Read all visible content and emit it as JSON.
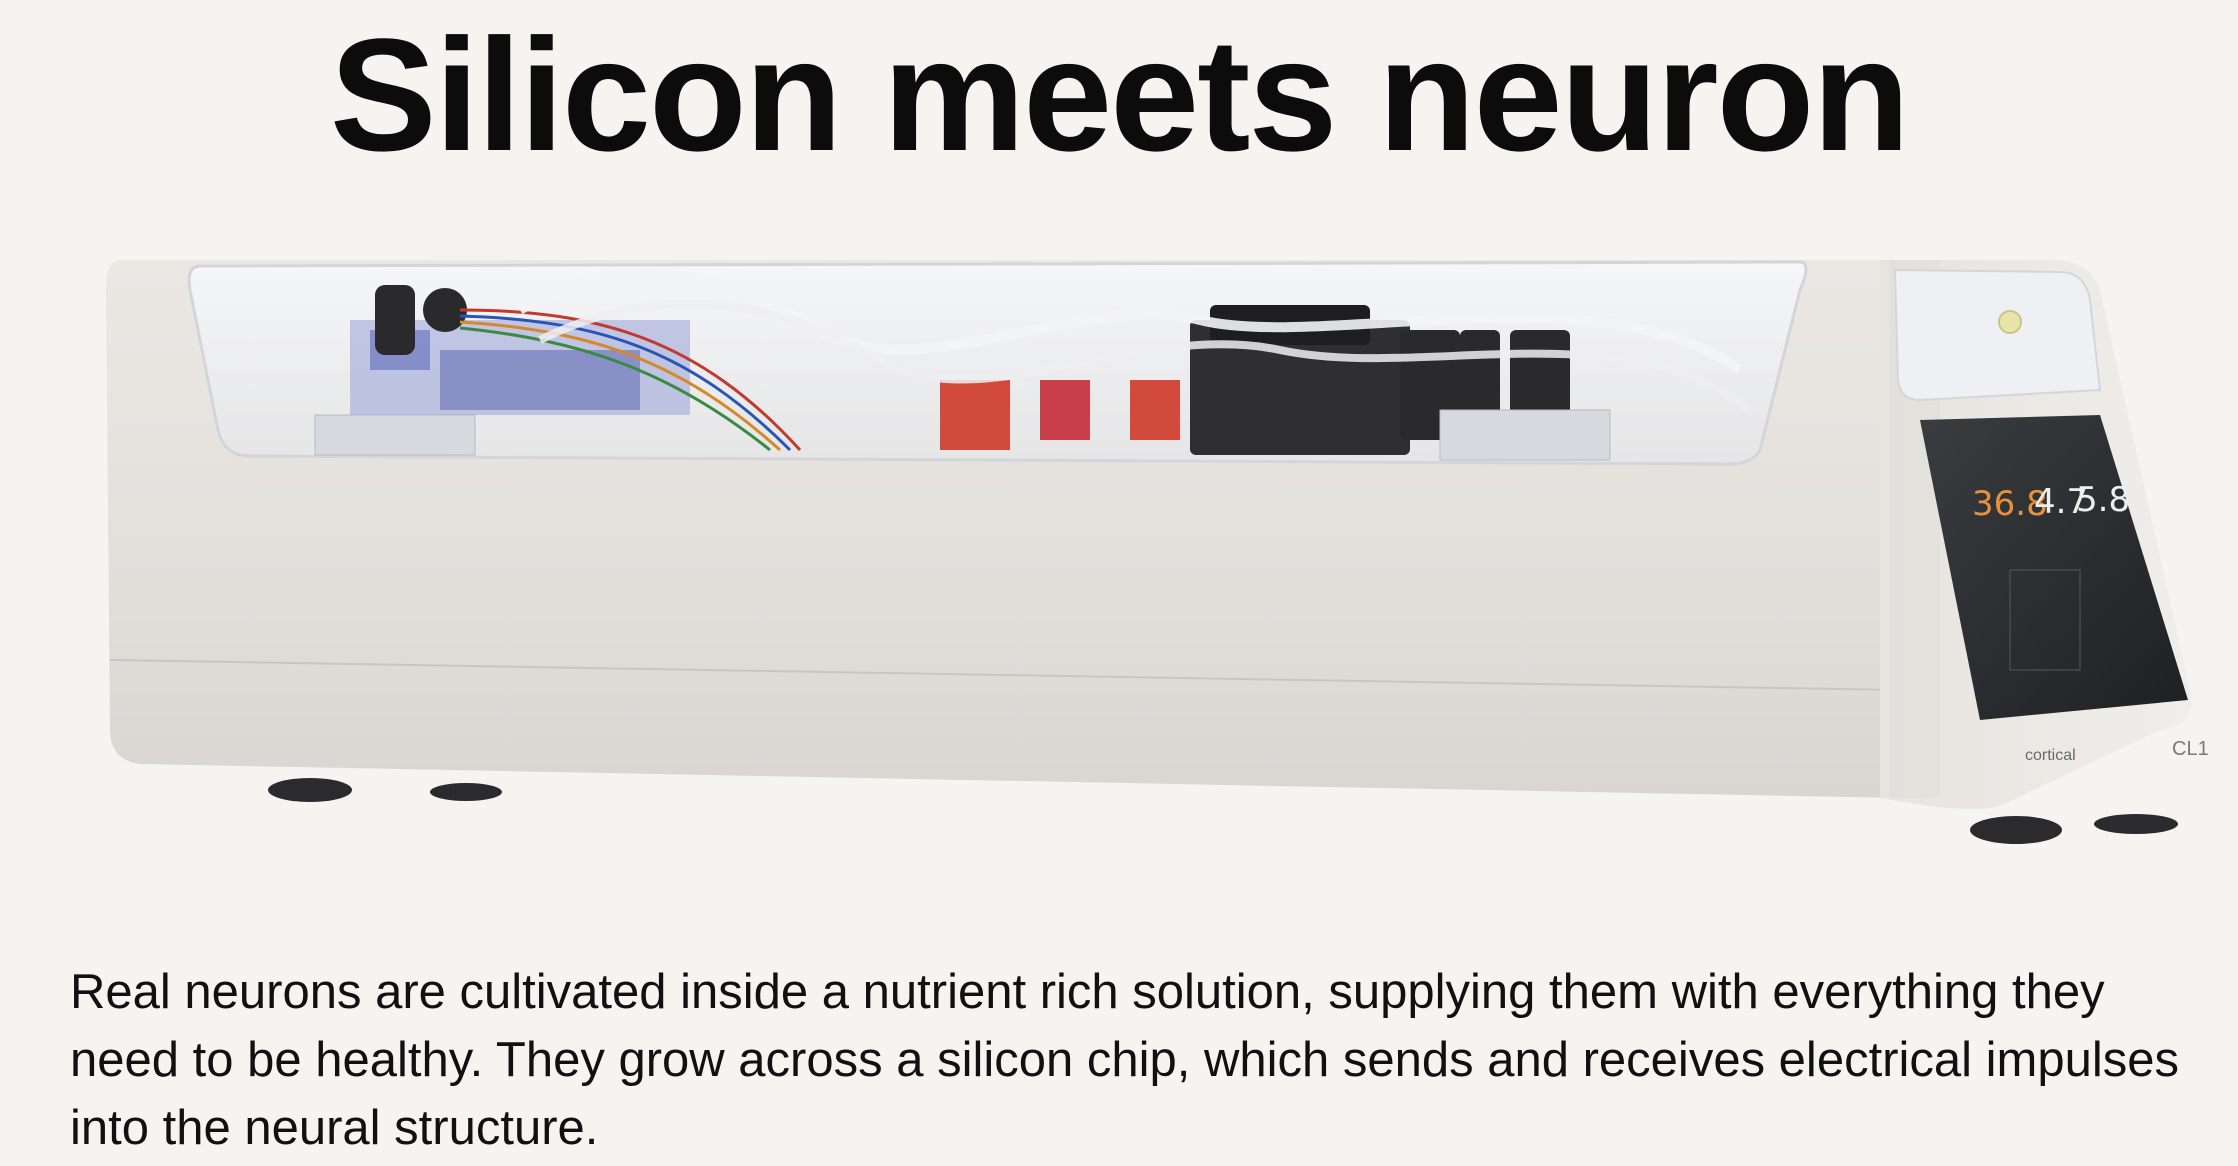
{
  "page": {
    "headline": "Silicon meets neuron",
    "description": "Real neurons are cultivated inside a nutrient rich solution, supplying them with everything they need to be healthy. They grow across a silicon chip, which sends and receives electrical impulses into the neural structure."
  },
  "device": {
    "product_image": "cl1-biological-computer",
    "screen": {
      "readings": [
        {
          "value": "36.8",
          "color": "#e8913a"
        },
        {
          "value": "4.7",
          "color": "#eeeeee"
        },
        {
          "value": "5.8",
          "color": "#eeeeee"
        }
      ]
    },
    "brand_logo": "cortical",
    "model_label": "CL1"
  },
  "colors": {
    "background": "#f5f4f0",
    "device_body": "#e6e3df",
    "accent_reading": "#e8913a"
  }
}
